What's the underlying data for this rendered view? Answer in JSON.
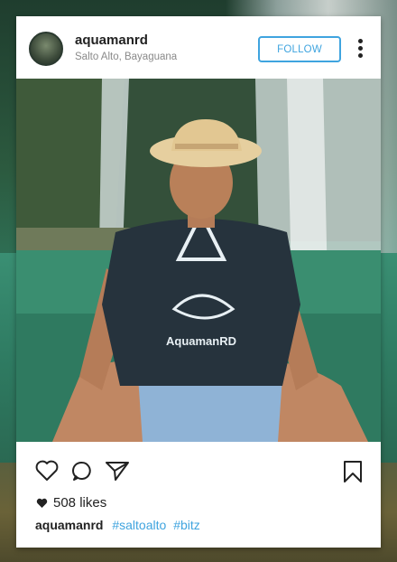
{
  "post": {
    "username": "aquamanrd",
    "location": "Salto Alto, Bayaguana",
    "follow_label": "FOLLOW",
    "likes": "508 likes",
    "caption": {
      "username": "aquamanrd",
      "hashtags": [
        "#saltoalto",
        "#bitz"
      ]
    },
    "shirt_text": "AquamanRD"
  },
  "icons": {
    "more": "more-vertical-icon",
    "like": "heart-outline-icon",
    "comment": "comment-bubble-icon",
    "share": "paper-plane-icon",
    "save": "bookmark-icon",
    "likes_heart": "heart-filled-icon"
  },
  "colors": {
    "accent": "#3fa4df",
    "text": "#222222",
    "muted": "#8a8a8a"
  }
}
